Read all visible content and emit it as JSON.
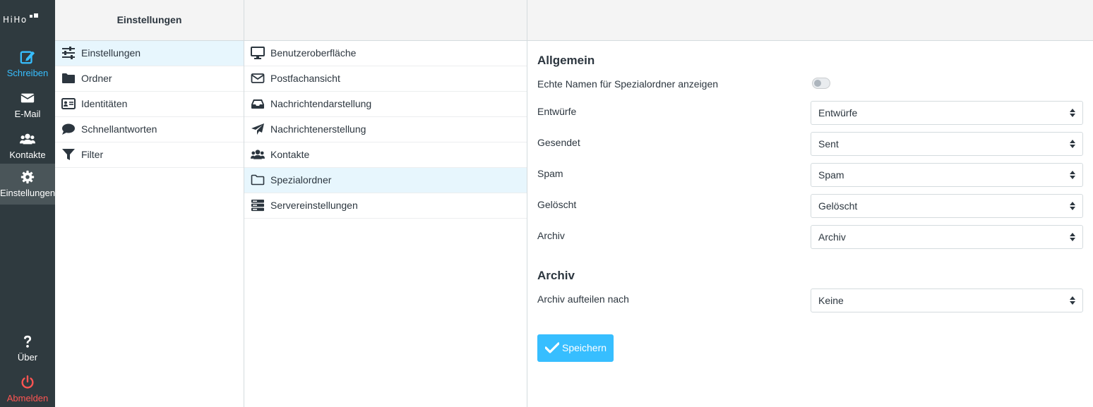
{
  "nav": {
    "logo": "HiHo",
    "items": [
      {
        "label": "Schreiben",
        "icon": "compose-icon"
      },
      {
        "label": "E-Mail",
        "icon": "envelope-icon"
      },
      {
        "label": "Kontakte",
        "icon": "users-icon"
      },
      {
        "label": "Einstellungen",
        "icon": "gear-icon"
      }
    ],
    "bottom": [
      {
        "label": "Über",
        "icon": "question-icon"
      },
      {
        "label": "Abmelden",
        "icon": "power-icon"
      }
    ]
  },
  "settings_column": {
    "title": "Einstellungen",
    "items": [
      {
        "label": "Einstellungen",
        "icon": "sliders-icon"
      },
      {
        "label": "Ordner",
        "icon": "folder-icon"
      },
      {
        "label": "Identitäten",
        "icon": "id-card-icon"
      },
      {
        "label": "Schnellantworten",
        "icon": "comment-icon"
      },
      {
        "label": "Filter",
        "icon": "filter-icon"
      }
    ]
  },
  "sections_column": {
    "items": [
      {
        "label": "Benutzeroberfläche",
        "icon": "monitor-icon"
      },
      {
        "label": "Postfachansicht",
        "icon": "envelope-outline-icon"
      },
      {
        "label": "Nachrichtendarstellung",
        "icon": "inbox-icon"
      },
      {
        "label": "Nachrichtenerstellung",
        "icon": "paper-plane-icon"
      },
      {
        "label": "Kontakte",
        "icon": "users-icon"
      },
      {
        "label": "Spezialordner",
        "icon": "folder-outline-icon"
      },
      {
        "label": "Servereinstellungen",
        "icon": "server-icon"
      }
    ]
  },
  "form": {
    "section_general": "Allgemein",
    "show_real_names_label": "Echte Namen für Spezialordner anzeigen",
    "show_real_names_enabled": false,
    "fields": [
      {
        "label": "Entwürfe",
        "value": "Entwürfe"
      },
      {
        "label": "Gesendet",
        "value": "Sent"
      },
      {
        "label": "Spam",
        "value": "Spam"
      },
      {
        "label": "Gelöscht",
        "value": "Gelöscht"
      },
      {
        "label": "Archiv",
        "value": "Archiv"
      }
    ],
    "section_archive": "Archiv",
    "archive_split_label": "Archiv aufteilen nach",
    "archive_split_value": "Keine",
    "save_label": "Speichern"
  },
  "colors": {
    "nav_bg": "#2f3a3f",
    "accent": "#37beff",
    "logout": "#ff5552",
    "selected_row": "#e7f6fd"
  }
}
